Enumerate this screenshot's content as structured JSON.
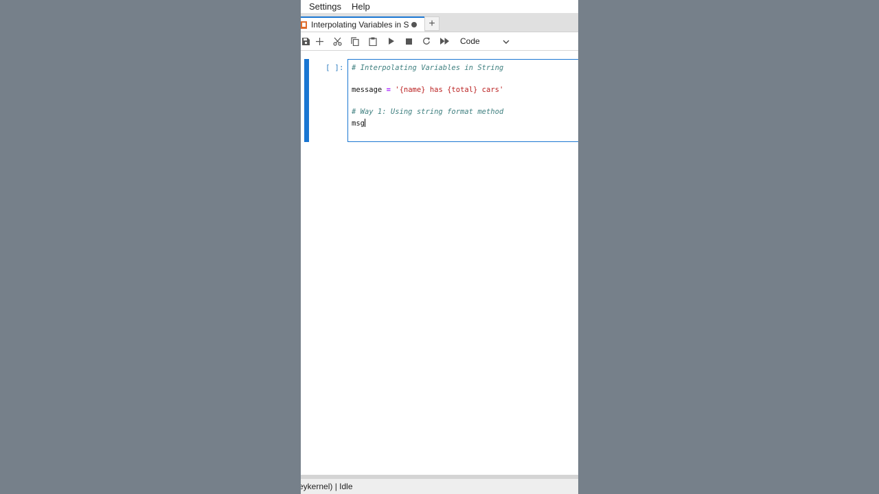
{
  "menu": {
    "items": [
      "Settings",
      "Help"
    ]
  },
  "tab": {
    "title": "Interpolating Variables in String.ipynb",
    "unsaved_indicator": "dot-icon"
  },
  "toolbar": {
    "buttons": [
      "save-icon",
      "add-cell-icon",
      "cut-icon",
      "copy-icon",
      "paste-icon",
      "run-icon",
      "stop-icon",
      "restart-icon",
      "fast-forward-icon"
    ],
    "cell_type": "Code"
  },
  "cell": {
    "prompt": "[ ]:",
    "lines": {
      "l1": "# Interpolating Variables in String",
      "l2_name": "message",
      "l2_op": "=",
      "l2_string": "'{name} has {total} cars'",
      "l3": "# Way 1: Using string format method",
      "l4": "msg"
    }
  },
  "status": {
    "text": "eykernel) | Idle"
  },
  "colors": {
    "accent": "#1976d2",
    "background": "#76808a",
    "comment": "#408080",
    "string": "#ba2121",
    "operator": "#aa22ff"
  }
}
